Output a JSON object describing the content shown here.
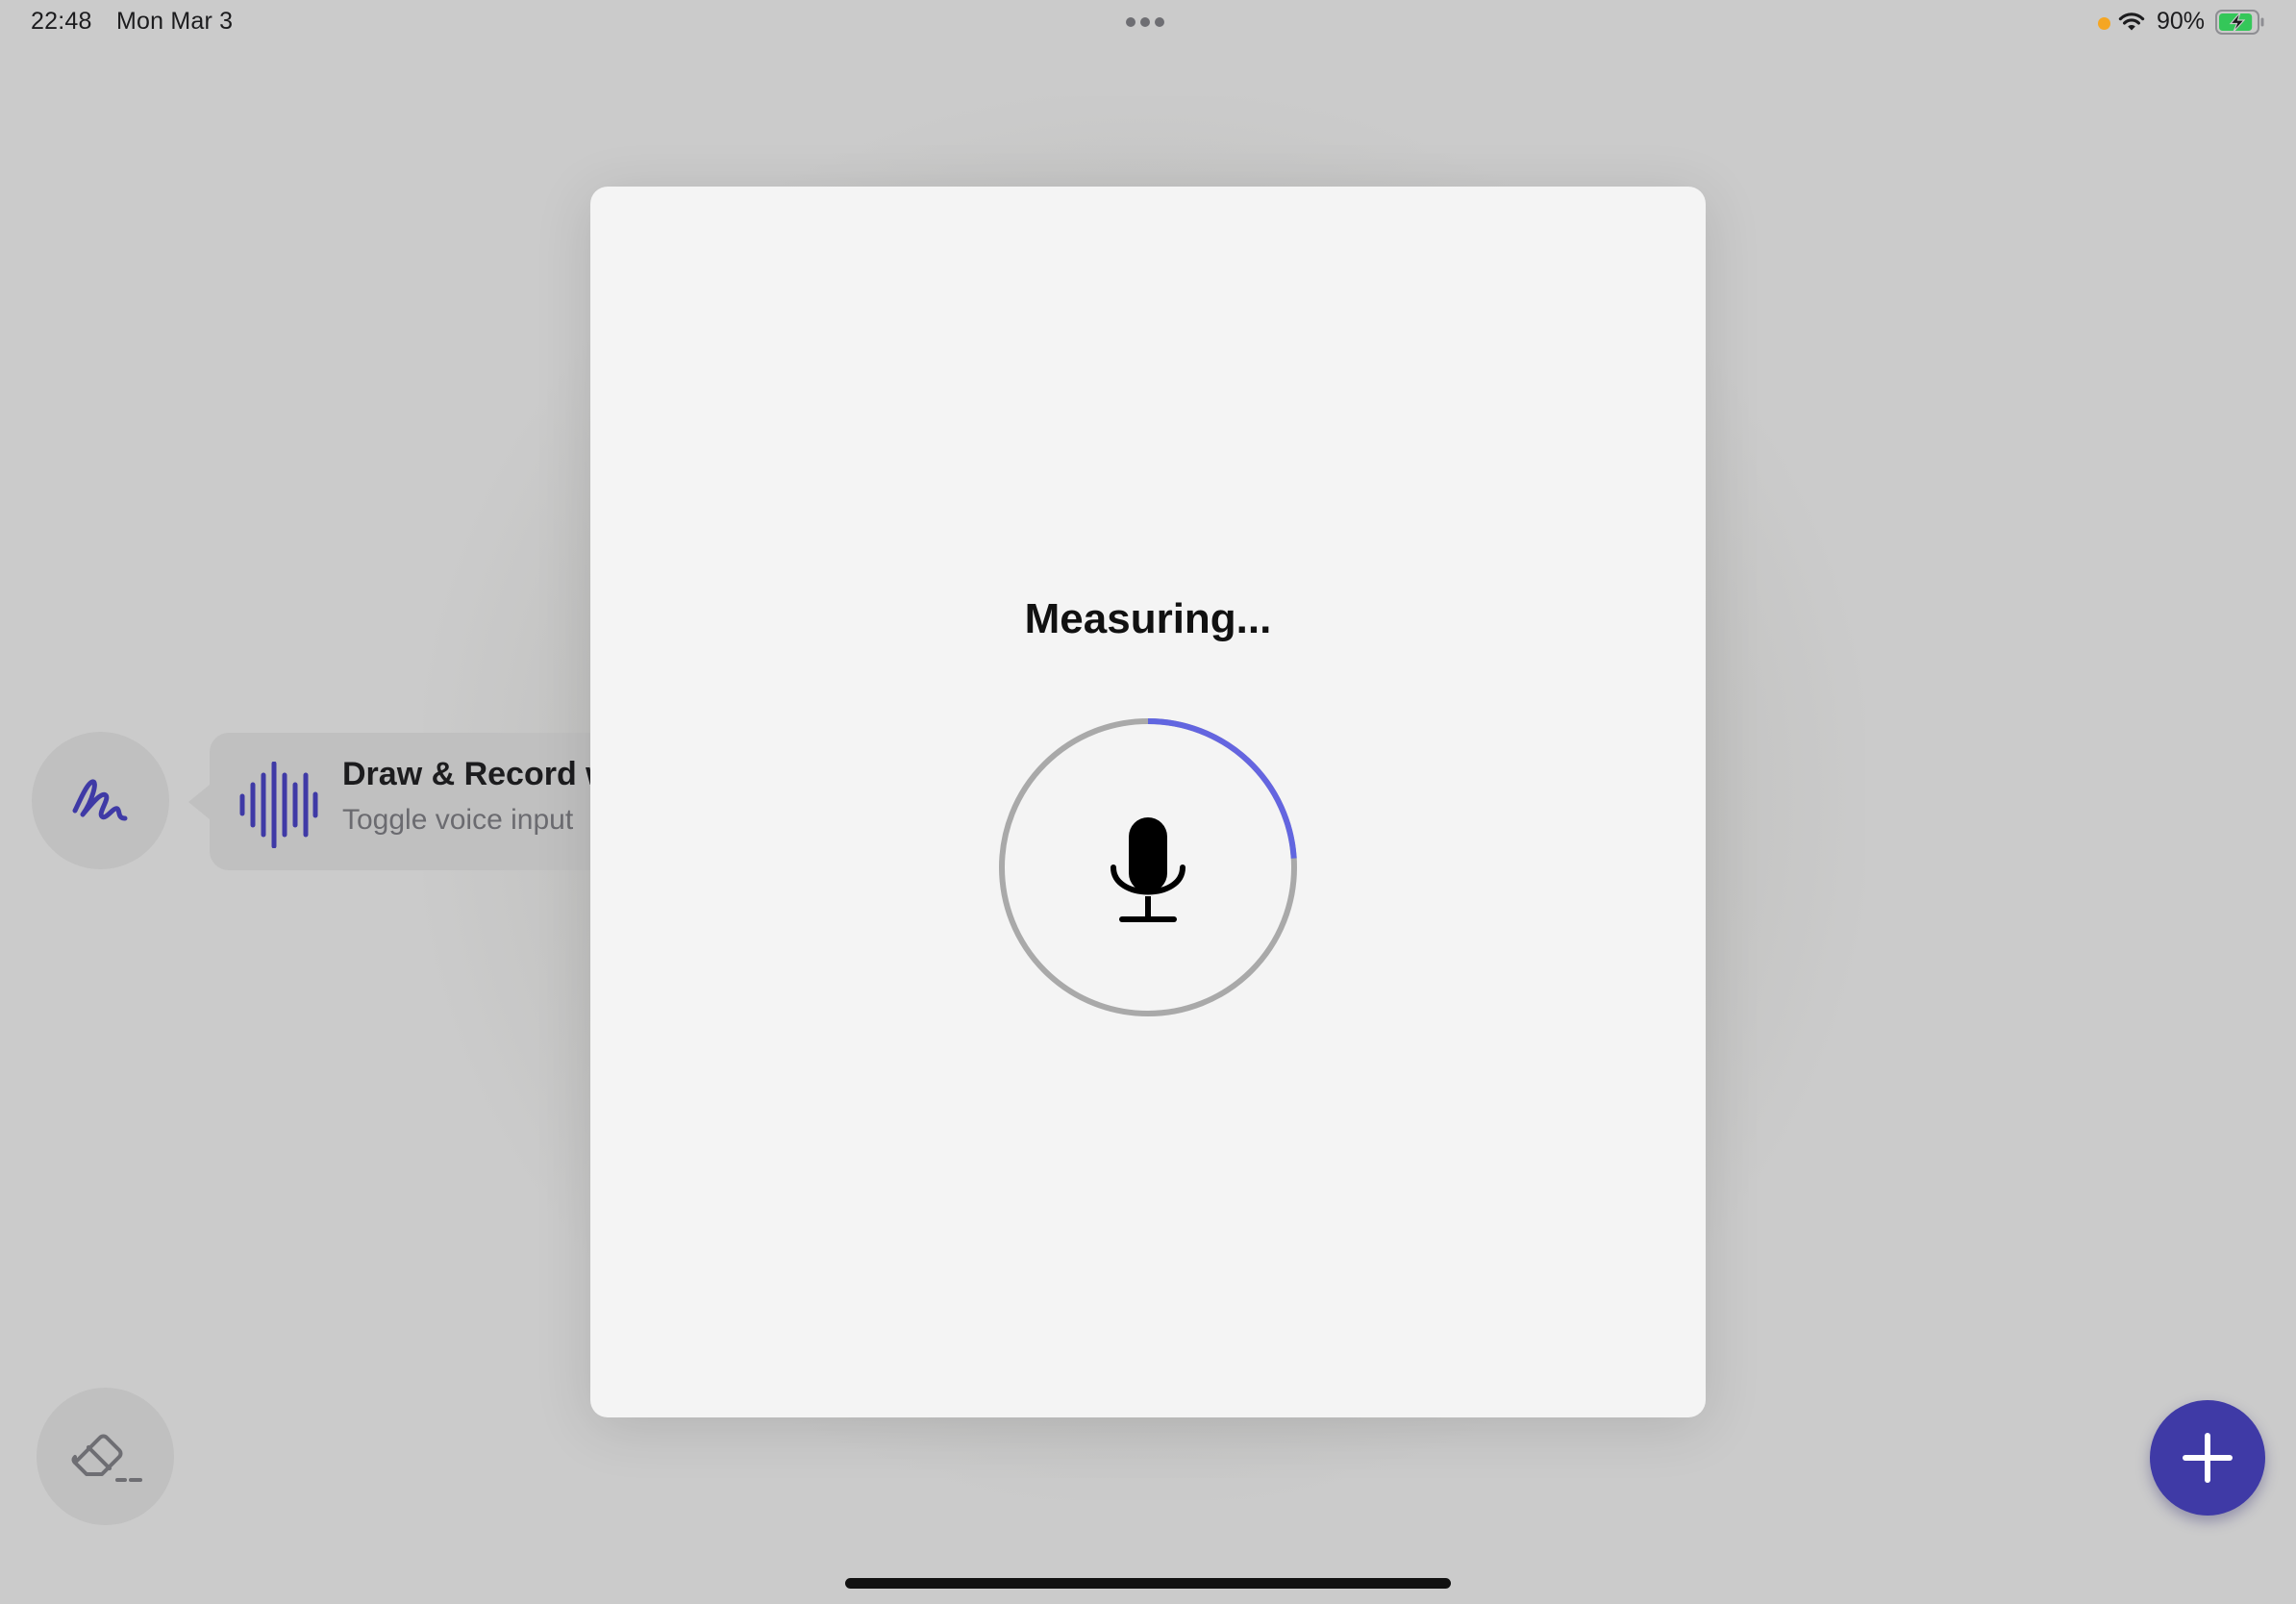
{
  "status_bar": {
    "time": "22:48",
    "date": "Mon Mar 3",
    "battery_percent": "90%",
    "battery_level": 0.9,
    "charging": true,
    "privacy_indicator_color": "#f5a623"
  },
  "left_toolbar": {
    "pen_icon": "scribble-pen-icon",
    "tooltip": {
      "icon": "waveform-icon",
      "title": "Draw & Record w",
      "subtitle": "Toggle voice input"
    },
    "eraser_icon": "eraser-icon"
  },
  "add_button": {
    "icon": "plus-icon",
    "color": "#3f3aa6"
  },
  "modal": {
    "title": "Measuring...",
    "mic_icon": "microphone-icon",
    "progress_fraction": 0.24,
    "progress_color_start": "#3b6fe0",
    "progress_color_end": "#6c63e0",
    "track_color": "#a9a9a9"
  },
  "accent_color": "#3f3aa6"
}
